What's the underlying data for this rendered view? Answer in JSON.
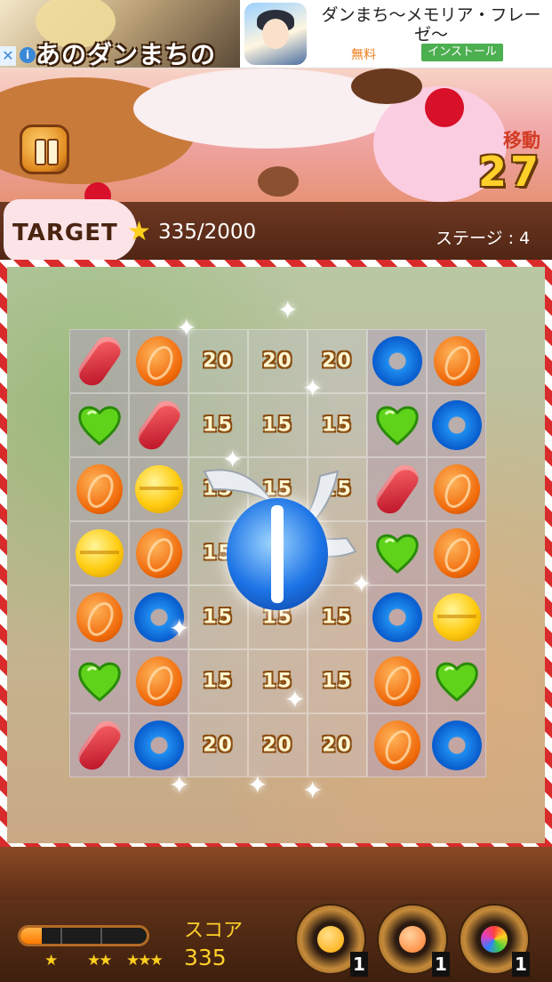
{
  "ad": {
    "close_icon": "close-icon",
    "info_icon": "info-icon",
    "banner_logo": "あのダンまちの",
    "title": "ダンまち〜メモリア・フレーゼ〜",
    "price": "無料",
    "install_label": "インストール"
  },
  "hud_top": {
    "moves_label": "移動",
    "moves_value": "27",
    "target_label": "TARGET",
    "target_value": "335/2000",
    "stage_label": "ステージ : 4"
  },
  "board": {
    "rows": [
      [
        "jelly",
        "orange",
        "20",
        "20",
        "20",
        "blue",
        "orange"
      ],
      [
        "heart",
        "jelly",
        "15",
        "15",
        "15",
        "heart",
        "blue"
      ],
      [
        "orange",
        "yellow",
        "15",
        "15",
        "15",
        "jelly",
        "orange"
      ],
      [
        "yellow",
        "orange",
        "15",
        "",
        "",
        "heart",
        "orange"
      ],
      [
        "orange",
        "blue",
        "15",
        "15",
        "15",
        "blue",
        "yellow"
      ],
      [
        "heart",
        "orange",
        "15",
        "15",
        "15",
        "orange",
        "heart"
      ],
      [
        "jelly",
        "blue",
        "20",
        "20",
        "20",
        "orange",
        "blue"
      ]
    ]
  },
  "hud_bottom": {
    "score_label": "スコア",
    "score_value": "335",
    "progress_fraction": 0.17,
    "star_tiers": [
      "★",
      "★★",
      "★★★"
    ],
    "boosters": [
      {
        "name": "orange-orb-booster",
        "count": "1",
        "color": "#ffa600"
      },
      {
        "name": "star-orb-booster",
        "count": "1",
        "color": "#ff7a2a"
      },
      {
        "name": "rainbow-orb-booster",
        "count": "1",
        "color": "#e040c0"
      }
    ]
  },
  "colors": {
    "accent_gold": "#ffd02a",
    "moves_red": "#d23b24",
    "install_green": "#4caf50"
  }
}
